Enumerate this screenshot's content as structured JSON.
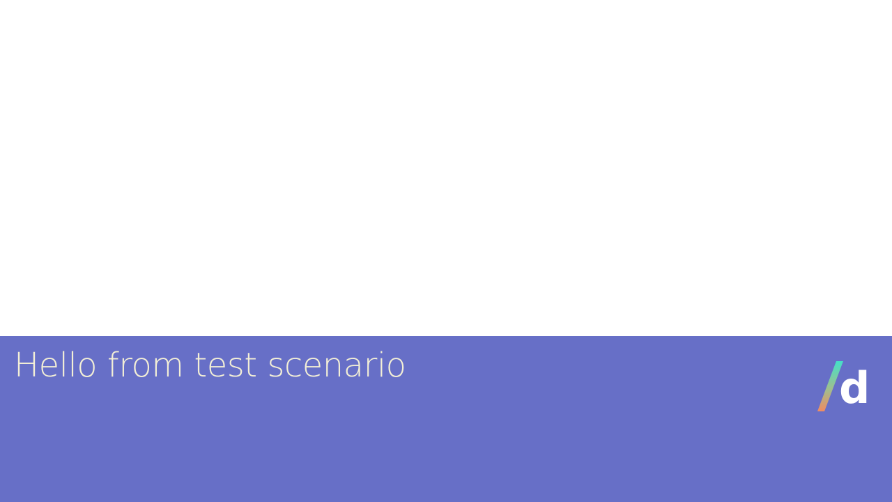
{
  "colors": {
    "panel_background": "#676fc7",
    "message_text": "#f3efd6",
    "logo_letter": "#ffffff",
    "logo_slash_gradient": [
      "#5ee0c2",
      "#f08b62"
    ]
  },
  "panel": {
    "message": "Hello from test scenario"
  },
  "logo": {
    "icon": "slash-d-logo-icon",
    "letter": "d"
  }
}
